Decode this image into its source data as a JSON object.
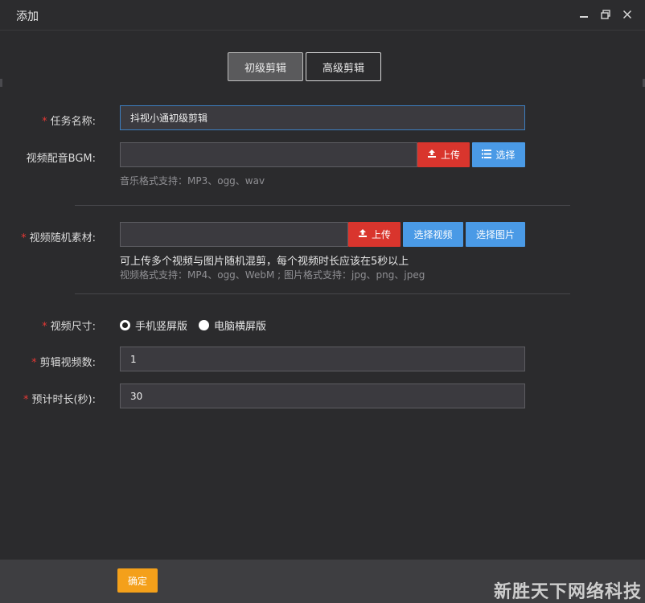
{
  "window": {
    "title": "添加"
  },
  "tabs": [
    {
      "label": "初级剪辑",
      "active": true
    },
    {
      "label": "高级剪辑",
      "active": false
    }
  ],
  "form": {
    "task_name": {
      "label": "任务名称:",
      "required": true,
      "value": "抖视小通初级剪辑"
    },
    "bgm": {
      "label": "视频配音BGM:",
      "required": false,
      "value": "",
      "upload_label": "上传",
      "select_label": "选择",
      "hint": "音乐格式支持：MP3、ogg、wav"
    },
    "material": {
      "label": "视频随机素材:",
      "required": true,
      "value": "",
      "upload_label": "上传",
      "select_video_label": "选择视频",
      "select_image_label": "选择图片",
      "hint_main": "可上传多个视频与图片随机混剪，每个视频时长应该在5秒以上",
      "hint_formats": "视频格式支持：MP4、ogg、WebM ; 图片格式支持：jpg、png、jpeg"
    },
    "size": {
      "label": "视频尺寸:",
      "required": true,
      "options": [
        {
          "label": "手机竖屏版",
          "checked": true
        },
        {
          "label": "电脑横屏版",
          "checked": false
        }
      ]
    },
    "count": {
      "label": "剪辑视频数:",
      "required": true,
      "value": "1"
    },
    "duration": {
      "label": "预计时长(秒):",
      "required": true,
      "value": "30"
    }
  },
  "footer": {
    "confirm_label": "确定"
  },
  "watermark": "新胜天下网络科技",
  "colors": {
    "primary_blue": "#4a9ae6",
    "upload_red": "#d9352d",
    "confirm_orange": "#f4a01a",
    "required_red": "#e53935"
  }
}
